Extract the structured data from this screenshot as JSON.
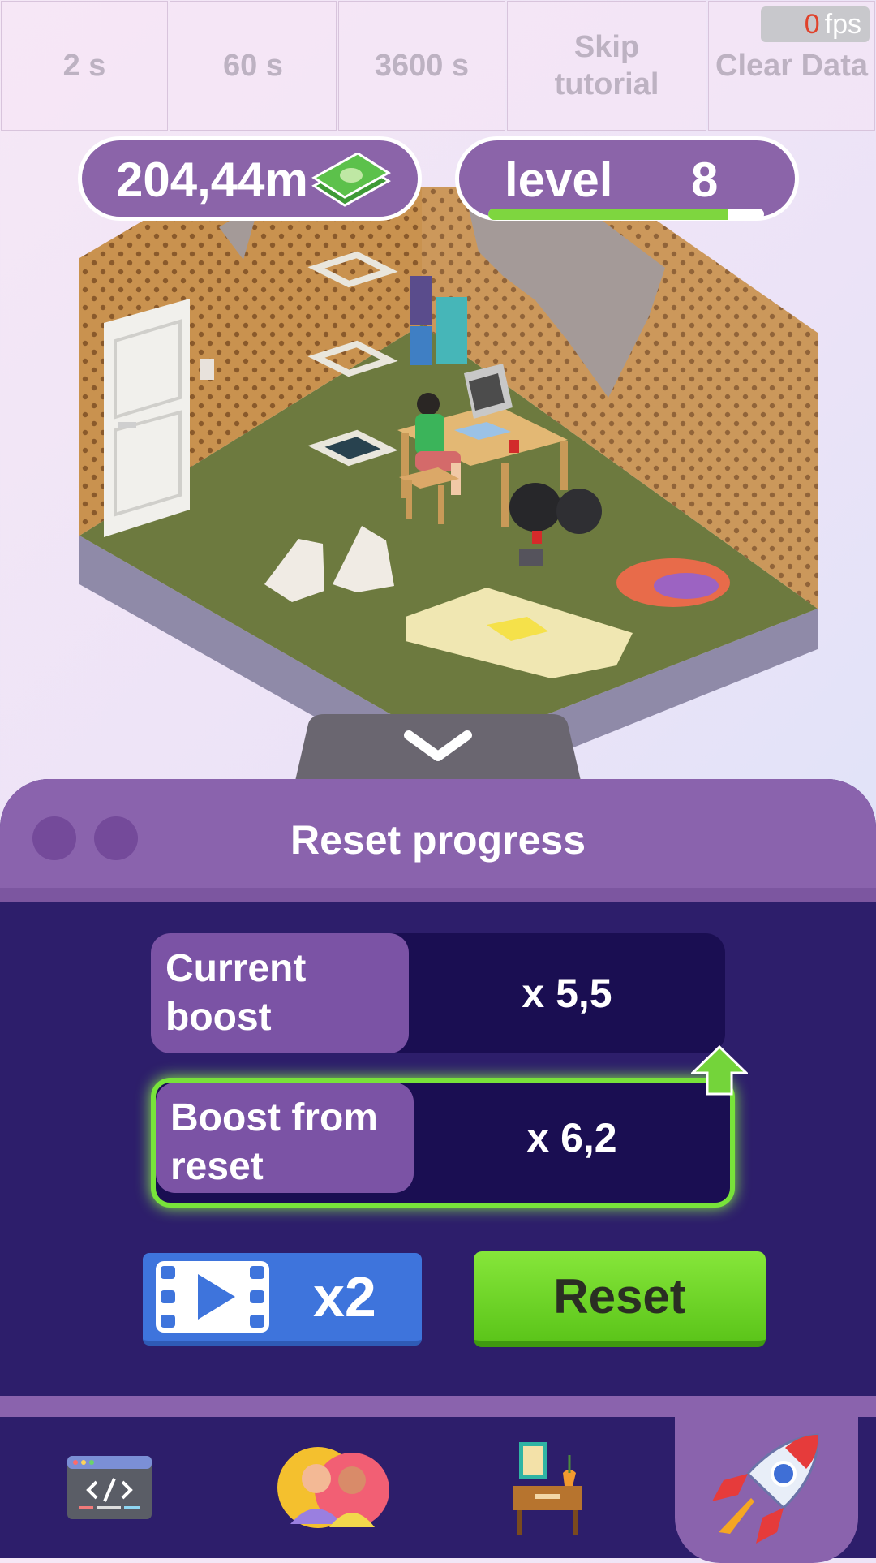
{
  "debug": {
    "buttons": [
      "2 s",
      "60 s",
      "3600 s",
      "Skip tutorial",
      "Clear Data"
    ],
    "fps_value": "0",
    "fps_unit": "fps"
  },
  "hud": {
    "money": "204,44m",
    "level_label": "level",
    "level_value": "8",
    "level_progress": 0.87
  },
  "panel": {
    "title": "Reset progress",
    "current_boost_label": "Current boost",
    "current_boost_value": "x 5,5",
    "reset_boost_label": "Boost from reset",
    "reset_boost_value": "x 6,2",
    "video_multiplier": "x2",
    "reset_label": "Reset"
  },
  "nav": {
    "tabs": [
      "code-icon",
      "people-icon",
      "furniture-icon",
      "rocket-icon"
    ],
    "active": "rocket-icon"
  },
  "colors": {
    "panel_bg": "#2d1e6b",
    "panel_header": "#8a63ad",
    "accent_green": "#78e33a",
    "video_blue": "#3e74dc",
    "hud_purple": "#8b64a9"
  }
}
